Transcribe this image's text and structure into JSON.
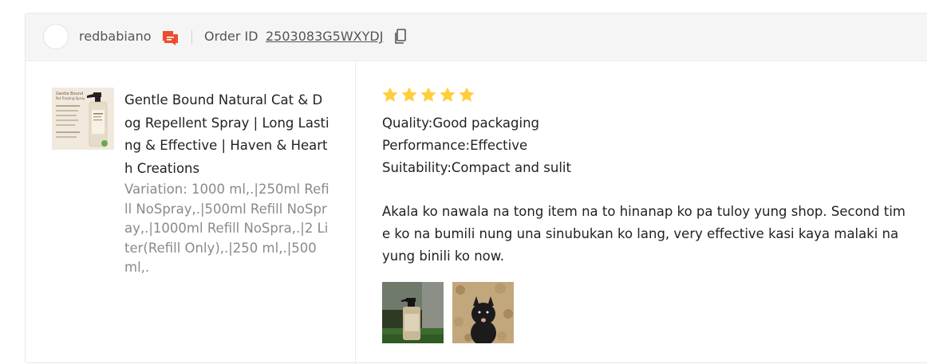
{
  "header": {
    "username": "redbabiano",
    "order_label": "Order ID",
    "order_id": "2503083G5WXYDJ",
    "icons": {
      "avatar": "avatar",
      "chat": "chat-icon",
      "copy": "copy-icon"
    },
    "colors": {
      "chat_icon": "#ee4d2d"
    }
  },
  "product": {
    "name": "Gentle Bound Natural Cat & Dog Repellent Spray | Long Lasting & Effective | Haven & Hearth Creations",
    "variation": "Variation: 1000 ml,.|250ml Refill NoSpray,.|500ml Refill NoSpray,.|1000ml Refill NoSpra,.|2 Liter(Refill Only),.|250 ml,.|500 ml,.",
    "thumbnail_text": {
      "brand": "Gentle Bound",
      "subtitle": "Pet Training Spray"
    }
  },
  "review": {
    "rating": 5,
    "max_rating": 5,
    "star_color": "#ffce3d",
    "attributes": [
      "Quality:Good packaging",
      "Performance:Effective",
      "Suitability:Compact and sulit"
    ],
    "comment": "Akala ko nawala na tong item na to hinanap ko pa tuloy yung shop. Second time ko na bumili nung una sinubukan ko lang, very effective kasi kaya malaki na yung binili ko now.",
    "photos": [
      "spray-bottle-photo",
      "black-dog-photo"
    ]
  }
}
